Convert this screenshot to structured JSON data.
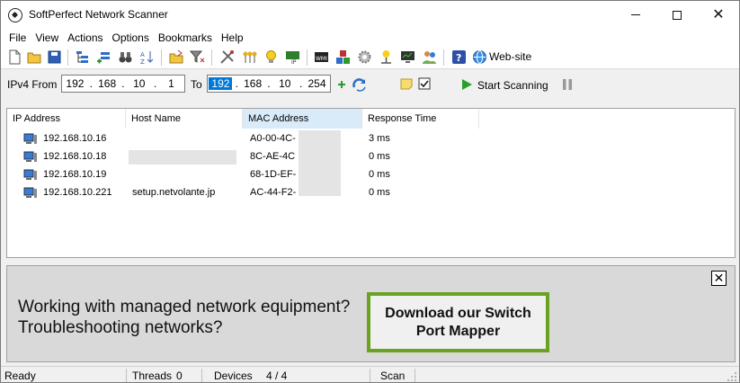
{
  "window": {
    "title": "SoftPerfect Network Scanner"
  },
  "menu": [
    "File",
    "View",
    "Actions",
    "Options",
    "Bookmarks",
    "Help"
  ],
  "toolbar": {
    "website_label": "Web-site"
  },
  "range": {
    "from_label": "IPv4 From",
    "from_octets": [
      "192",
      "168",
      "10",
      "1"
    ],
    "to_label": "To",
    "to_octets": [
      "192",
      "168",
      "10",
      "254"
    ],
    "start_label": "Start Scanning"
  },
  "table": {
    "columns": [
      "IP Address",
      "Host Name",
      "MAC Address",
      "Response Time"
    ],
    "rows": [
      {
        "ip": "192.168.10.16",
        "host": "",
        "mac": "A0-00-4C-",
        "time": "3 ms"
      },
      {
        "ip": "192.168.10.18",
        "host": "",
        "mac": "8C-AE-4C",
        "time": "0 ms"
      },
      {
        "ip": "192.168.10.19",
        "host": "",
        "mac": "68-1D-EF-",
        "time": "0 ms"
      },
      {
        "ip": "192.168.10.221",
        "host": "setup.netvolante.jp",
        "mac": "AC-44-F2-",
        "time": "0 ms"
      }
    ]
  },
  "ad": {
    "text": "Working with managed network equipment? Troubleshooting networks?",
    "button": "Download our Switch Port Mapper",
    "close": "✕"
  },
  "status": {
    "ready": "Ready",
    "threads_label": "Threads",
    "threads_value": "0",
    "devices_label": "Devices",
    "devices_value": "4 / 4",
    "scan": "Scan"
  },
  "colors": {
    "accent_green": "#6aa321",
    "selection_blue": "#0078d7",
    "sorted_header": "#d9ebf9"
  }
}
